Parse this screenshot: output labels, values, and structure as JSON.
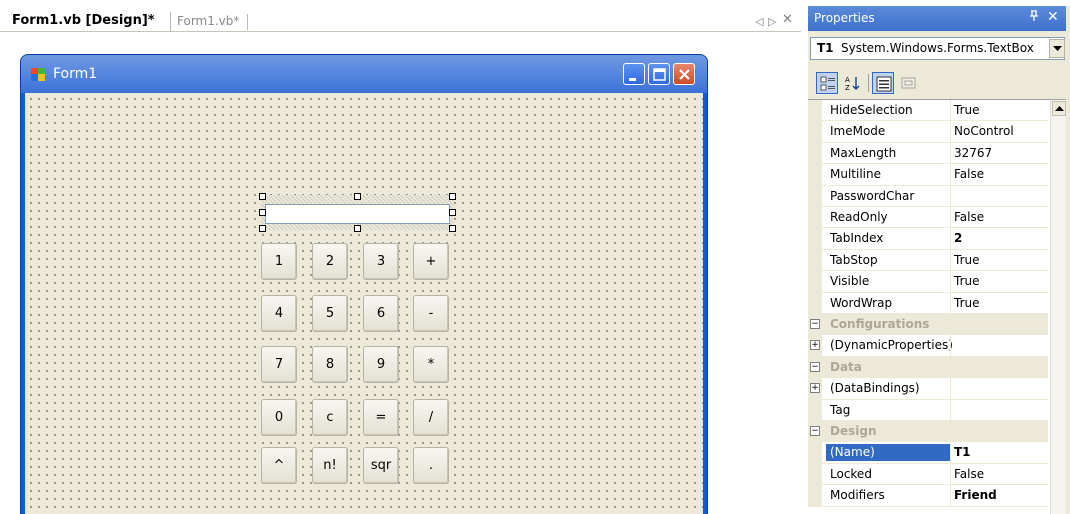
{
  "tabs": {
    "design": "Form1.vb [Design]*",
    "code": "Form1.vb*"
  },
  "tab_controls": {
    "left": "◁",
    "right": "▷",
    "close": "✕"
  },
  "form": {
    "title": "Form1"
  },
  "calc_buttons": [
    [
      "1",
      "2",
      "3",
      "+"
    ],
    [
      "4",
      "5",
      "6",
      "-"
    ],
    [
      "7",
      "8",
      "9",
      "*"
    ],
    [
      "0",
      "c",
      "=",
      "/"
    ],
    [
      "^",
      "n!",
      "sqr",
      "."
    ]
  ],
  "properties": {
    "title": "Properties",
    "pin_glyph": "ᵩ",
    "close_glyph": "✕",
    "object_name": "T1",
    "object_type": "System.Windows.Forms.TextBox",
    "rows": [
      {
        "kind": "prop",
        "name": "HideSelection",
        "value": "True"
      },
      {
        "kind": "prop",
        "name": "ImeMode",
        "value": "NoControl"
      },
      {
        "kind": "prop",
        "name": "MaxLength",
        "value": "32767"
      },
      {
        "kind": "prop",
        "name": "Multiline",
        "value": "False"
      },
      {
        "kind": "prop",
        "name": "PasswordChar",
        "value": ""
      },
      {
        "kind": "prop",
        "name": "ReadOnly",
        "value": "False"
      },
      {
        "kind": "prop",
        "name": "TabIndex",
        "value": "2",
        "bold": true
      },
      {
        "kind": "prop",
        "name": "TabStop",
        "value": "True"
      },
      {
        "kind": "prop",
        "name": "Visible",
        "value": "True"
      },
      {
        "kind": "prop",
        "name": "WordWrap",
        "value": "True"
      },
      {
        "kind": "cat",
        "name": "Configurations",
        "expander": "⊟"
      },
      {
        "kind": "prop",
        "name": "(DynamicProperties)",
        "value": "",
        "expander": "+"
      },
      {
        "kind": "cat",
        "name": "Data",
        "expander": "⊟"
      },
      {
        "kind": "prop",
        "name": "(DataBindings)",
        "value": "",
        "expander": "+"
      },
      {
        "kind": "prop",
        "name": "Tag",
        "value": ""
      },
      {
        "kind": "cat",
        "name": "Design",
        "expander": "⊟"
      },
      {
        "kind": "prop",
        "name": "(Name)",
        "value": "T1",
        "bold": true,
        "selected": true
      },
      {
        "kind": "prop",
        "name": "Locked",
        "value": "False"
      },
      {
        "kind": "prop",
        "name": "Modifiers",
        "value": "Friend",
        "bold": true
      }
    ]
  },
  "colors": {
    "selection": "#316ac5",
    "titlebar": "#3b71d6",
    "form_back": "#ece9d8"
  }
}
